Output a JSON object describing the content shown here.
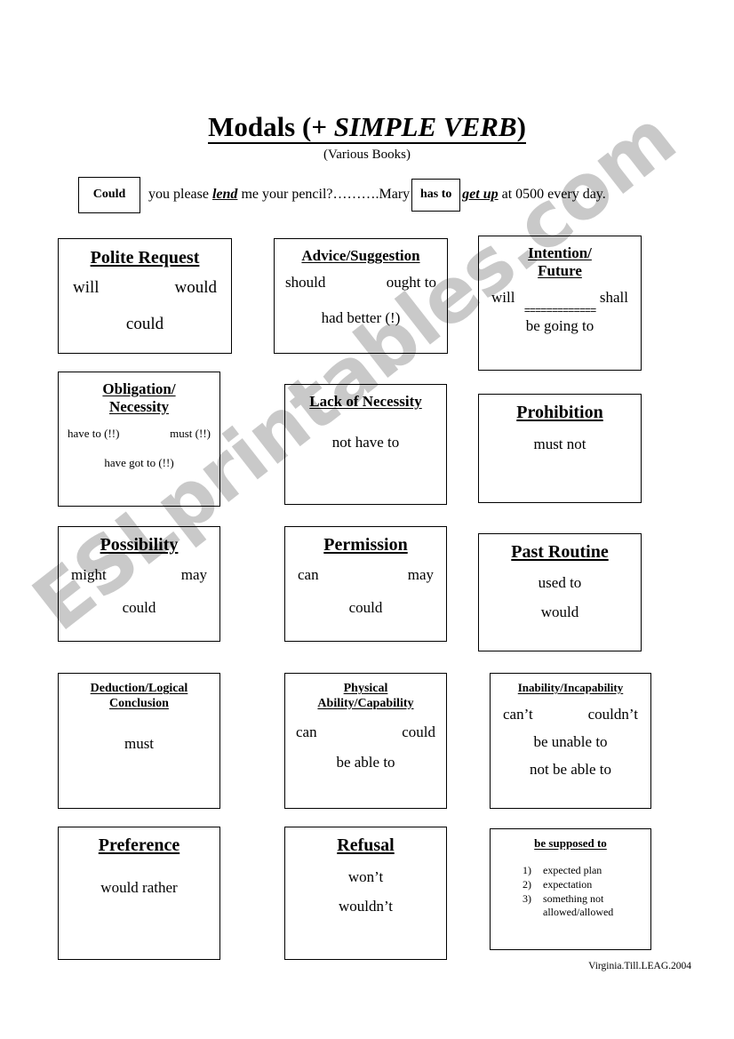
{
  "document": {
    "title_prefix": "Modals (+ ",
    "title_emphasis": "SIMPLE VERB",
    "title_suffix": ")",
    "subtitle": "(Various Books)",
    "footer_credit": "Virginia.Till.LEAG.2004",
    "watermark": "ESLprintables.com",
    "watermark_color": "#c9c9c9"
  },
  "example_sentence": {
    "chip_1": "Could",
    "segment_1_before": "you please ",
    "segment_1_bold": "lend",
    "segment_1_after": " me your pencil?……….Mary",
    "chip_2": "has to",
    "segment_2_bold": "get up",
    "segment_2_after": " at 0500 every day."
  },
  "boxes": [
    {
      "id": "polite-request",
      "heading": "Polite Request",
      "row_left": "will",
      "row_right": "would",
      "row_bottom": "could"
    },
    {
      "id": "advice-suggestion",
      "heading": "Advice/Suggestion",
      "row_left": "should",
      "row_right": "ought to",
      "row_bottom": "had better (!)"
    },
    {
      "id": "intention-future",
      "heading_line_1": "Intention/",
      "heading_line_2": "Future",
      "row_left": "will",
      "row_right": "shall",
      "separator": "=============",
      "row_bottom": "be going to"
    },
    {
      "id": "obligation-necessity",
      "heading_line_1": "Obligation/",
      "heading_line_2": "Necessity",
      "row_left": "have to (!!)",
      "row_right": "must (!!)",
      "row_bottom": "have got to (!!)"
    },
    {
      "id": "lack-of-necessity",
      "heading": "Lack of Necessity",
      "row_bottom": "not have to"
    },
    {
      "id": "prohibition",
      "heading": "Prohibition",
      "row_bottom": "must not"
    },
    {
      "id": "possibility",
      "heading": "Possibility",
      "row_left": "might",
      "row_right": "may",
      "row_bottom": "could"
    },
    {
      "id": "permission",
      "heading": "Permission",
      "row_left": "can",
      "row_right": "may",
      "row_bottom": "could"
    },
    {
      "id": "past-routine",
      "heading": "Past Routine",
      "row_1": "used to",
      "row_2": "would"
    },
    {
      "id": "deduction-logical-conclusion",
      "heading_line_1": "Deduction/Logical",
      "heading_line_2": "Conclusion",
      "row_bottom": "must"
    },
    {
      "id": "physical-ability",
      "heading_line_1": "Physical",
      "heading_line_2": "Ability/Capability",
      "row_left": "can",
      "row_right": "could",
      "row_bottom": "be able to"
    },
    {
      "id": "inability-incapability",
      "heading": "Inability/Incapability",
      "row_left": "can’t",
      "row_right": "couldn’t",
      "row_2": "be unable to",
      "row_3": "not be able to"
    },
    {
      "id": "preference",
      "heading": "Preference",
      "row_bottom": "would rather"
    },
    {
      "id": "refusal",
      "heading": "Refusal",
      "row_1": "won’t",
      "row_2": "wouldn’t"
    },
    {
      "id": "be-supposed-to",
      "heading": "be supposed to",
      "list": [
        {
          "num": "1)",
          "text": "expected plan"
        },
        {
          "num": "2)",
          "text": "expectation"
        },
        {
          "num": "3)",
          "text": "something not"
        },
        {
          "num": "",
          "text": "allowed/allowed"
        }
      ]
    }
  ]
}
